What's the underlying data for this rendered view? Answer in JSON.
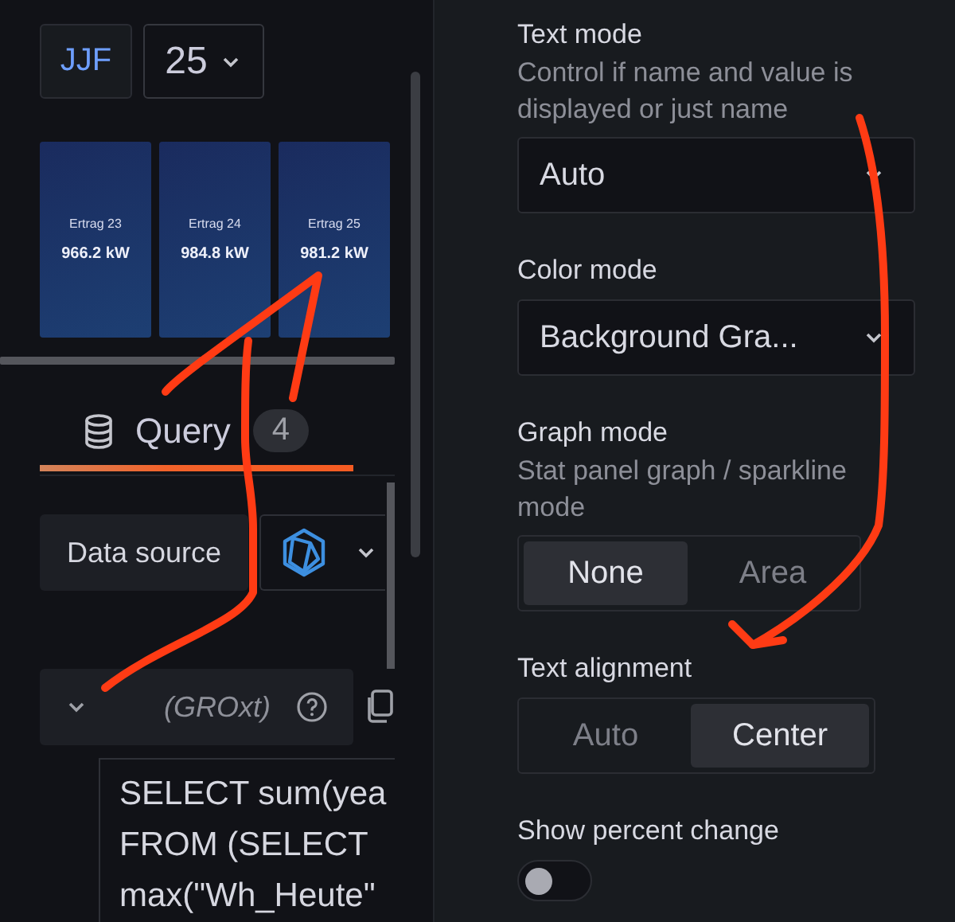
{
  "variable": {
    "label": "JJF",
    "value": "25"
  },
  "stat_tiles": [
    {
      "title": "Ertrag 23",
      "value": "966.2 kW"
    },
    {
      "title": "Ertrag 24",
      "value": "984.8 kW"
    },
    {
      "title": "Ertrag 25",
      "value": "981.2 kW"
    }
  ],
  "query_tab": {
    "label": "Query",
    "count": "4",
    "selected": true
  },
  "data_source": {
    "label": "Data source"
  },
  "query": {
    "name": "(GROxt)",
    "expanded": true,
    "sql_lines": [
      "SELECT sum(yea",
      "FROM (SELECT",
      "max(\"Wh_Heute\""
    ]
  },
  "options": [
    {
      "kind": "select",
      "title": "Text mode",
      "description": "Control if name and value is displayed or just name",
      "value": "Auto"
    },
    {
      "kind": "select",
      "title": "Color mode",
      "value": "Background Gra..."
    },
    {
      "kind": "radio",
      "title": "Graph mode",
      "description": "Stat panel graph / sparkline mode",
      "choices": [
        {
          "label": "None",
          "selected": true
        },
        {
          "label": "Area",
          "selected": false
        }
      ]
    },
    {
      "kind": "radio",
      "title": "Text alignment",
      "choices": [
        {
          "label": "Auto",
          "selected": false
        },
        {
          "label": "Center",
          "selected": true
        }
      ]
    },
    {
      "kind": "toggle",
      "title": "Show percent change",
      "on": false
    }
  ]
}
